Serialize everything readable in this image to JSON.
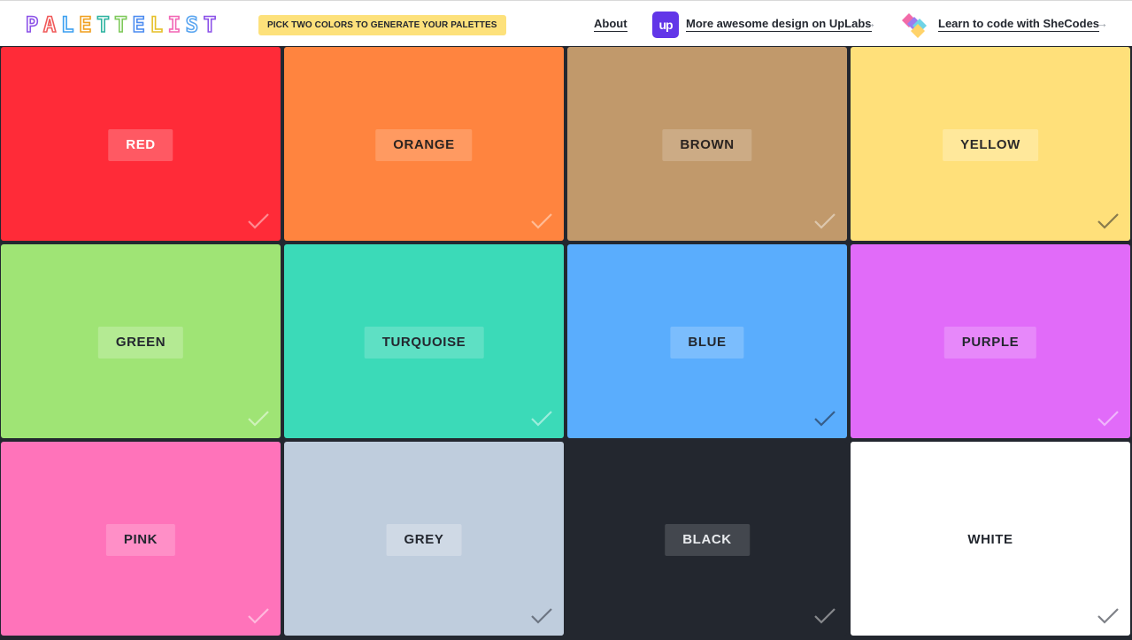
{
  "header": {
    "logo_letters": [
      "P",
      "A",
      "L",
      "E",
      "T",
      "T",
      "E",
      "L",
      "I",
      "S",
      "T"
    ],
    "pick_badge": "PICK TWO COLORS TO GENERATE YOUR PALETTES",
    "about_label": "About",
    "uplabs_logo_text": "up",
    "uplabs_label": "More awesome design on UpLabs",
    "shecodes_label": "Learn to code with SheCodes",
    "arrow_icon": "arrow-right-icon"
  },
  "colors": [
    {
      "label": "RED",
      "bg": "#ff2b38",
      "chip": "rgba(255,255,255,0.22)",
      "text": "#ffffff",
      "check": "rgba(255,255,255,0.45)"
    },
    {
      "label": "ORANGE",
      "bg": "#ff843f",
      "chip": "rgba(255,255,255,0.18)",
      "text": "#2a2320",
      "check": "rgba(255,255,255,0.45)"
    },
    {
      "label": "BROWN",
      "bg": "#c1996b",
      "chip": "rgba(255,255,255,0.18)",
      "text": "#2a2320",
      "check": "rgba(255,255,255,0.45)"
    },
    {
      "label": "YELLOW",
      "bg": "#ffe07a",
      "chip": "rgba(255,255,255,0.25)",
      "text": "#2a2a2a",
      "check": "rgba(40,40,40,0.55)"
    },
    {
      "label": "GREEN",
      "bg": "#9fe475",
      "chip": "rgba(255,255,255,0.22)",
      "text": "#23272f",
      "check": "rgba(255,255,255,0.5)"
    },
    {
      "label": "TURQUOISE",
      "bg": "#3bdab8",
      "chip": "rgba(255,255,255,0.18)",
      "text": "#23272f",
      "check": "rgba(255,255,255,0.5)"
    },
    {
      "label": "BLUE",
      "bg": "#5aadfd",
      "chip": "rgba(255,255,255,0.2)",
      "text": "#23272f",
      "check": "rgba(30,40,60,0.6)"
    },
    {
      "label": "PURPLE",
      "bg": "#e16bf9",
      "chip": "rgba(255,255,255,0.2)",
      "text": "#23272f",
      "check": "rgba(255,255,255,0.5)"
    },
    {
      "label": "PINK",
      "bg": "#ff73ba",
      "chip": "rgba(255,255,255,0.2)",
      "text": "#23272f",
      "check": "rgba(255,255,255,0.5)"
    },
    {
      "label": "GREY",
      "bg": "#bfcddd",
      "chip": "rgba(255,255,255,0.25)",
      "text": "#23272f",
      "check": "rgba(40,45,55,0.55)"
    },
    {
      "label": "BLACK",
      "bg": "#23272f",
      "chip": "rgba(255,255,255,0.15)",
      "text": "#e9ebee",
      "check": "rgba(255,255,255,0.45)"
    },
    {
      "label": "WHITE",
      "bg": "#ffffff",
      "chip": "rgba(255,255,255,0)",
      "text": "#23272f",
      "check": "rgba(40,45,55,0.6)"
    }
  ],
  "tile_check_icon": "checkmark-icon"
}
